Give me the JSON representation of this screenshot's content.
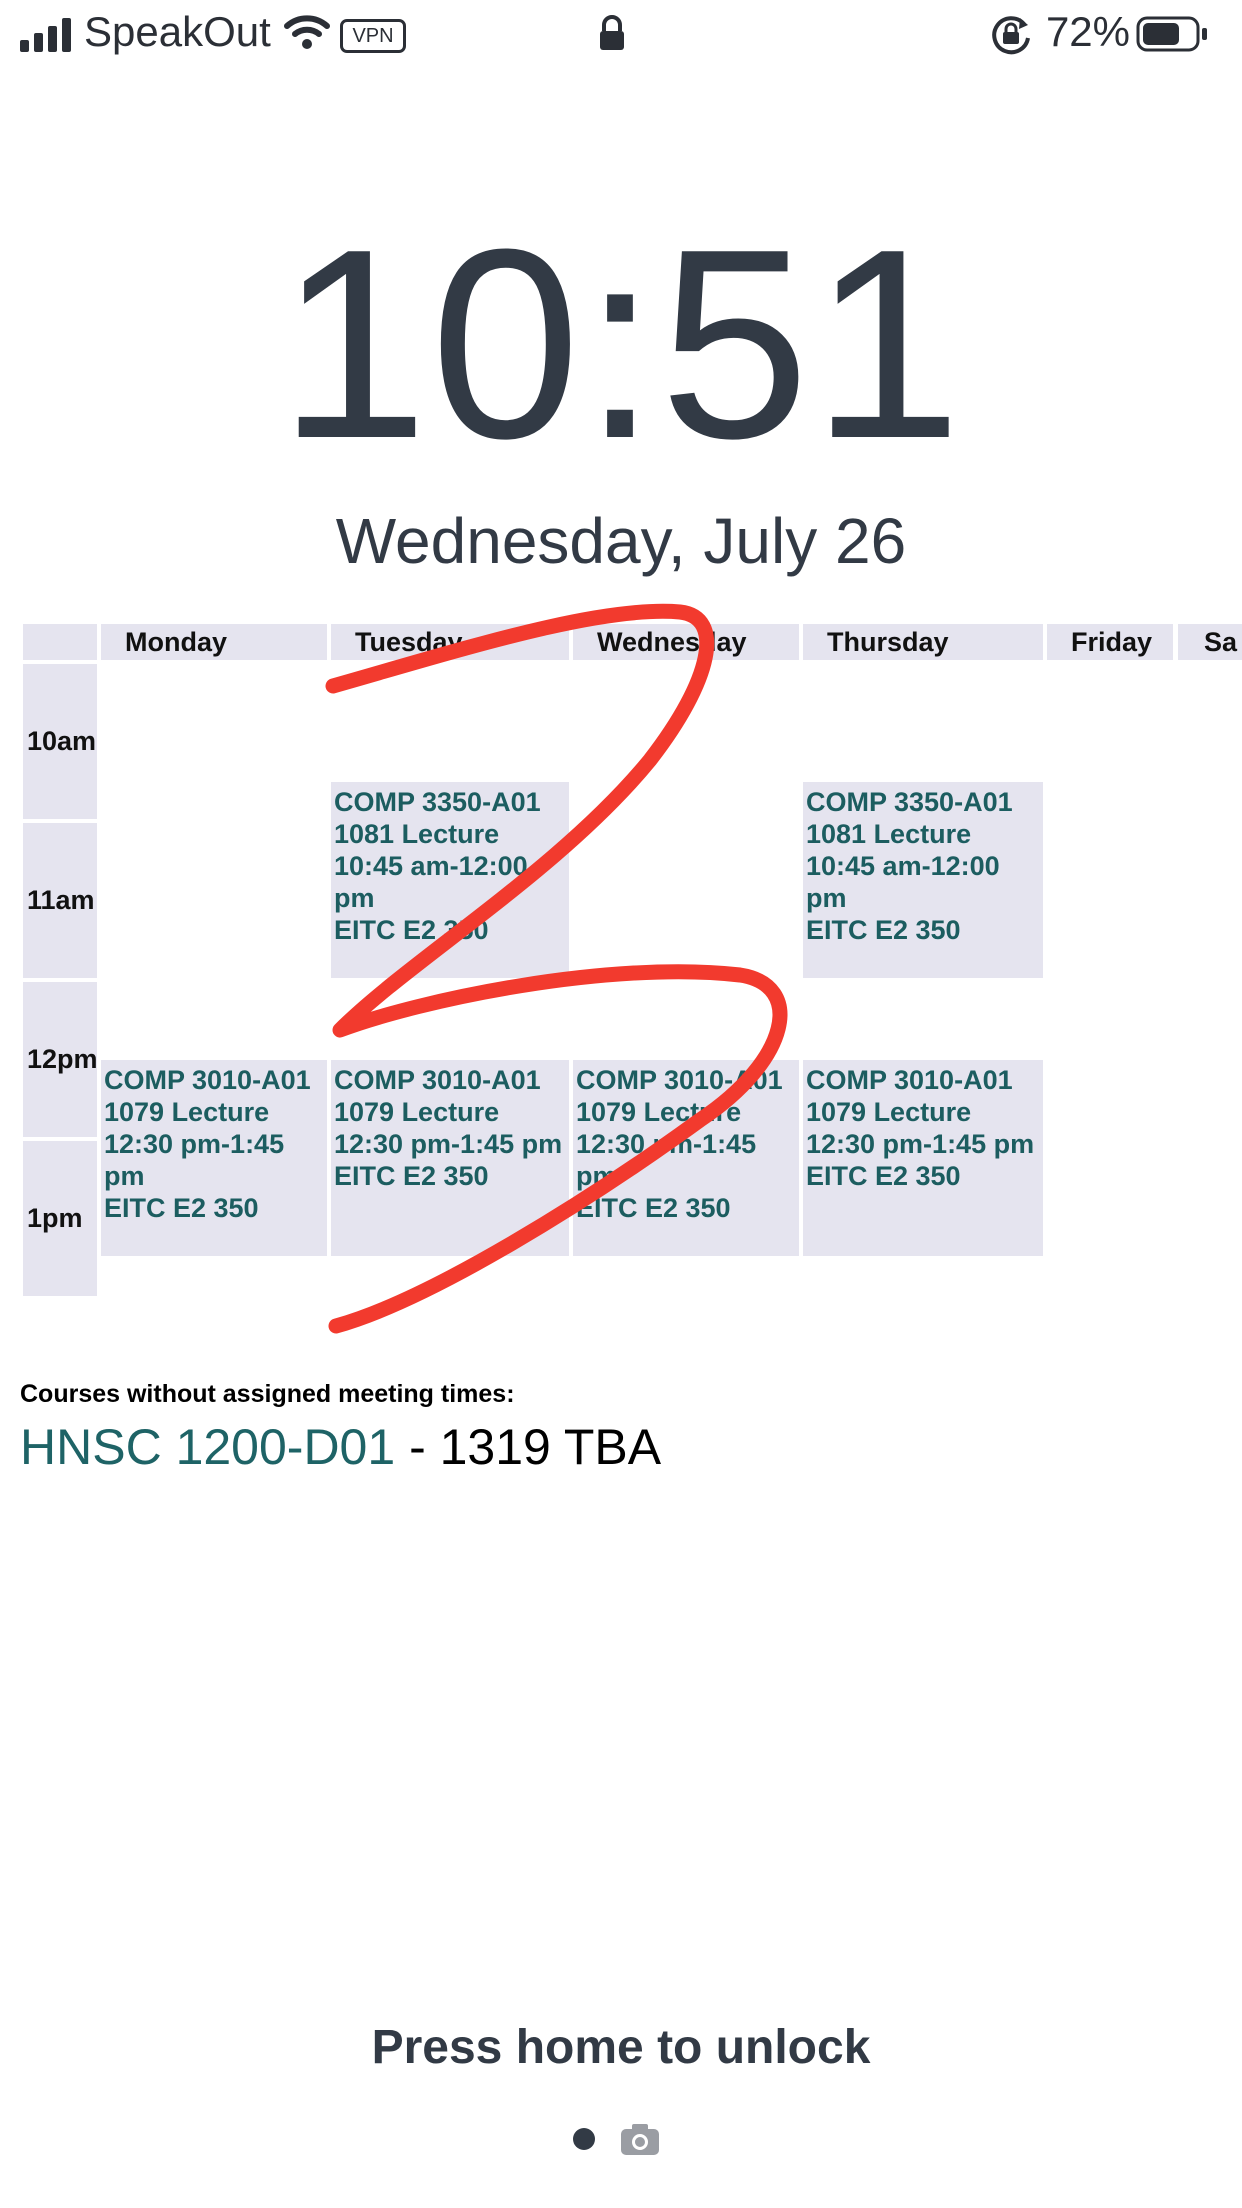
{
  "status_bar": {
    "carrier": "SpeakOut",
    "vpn_label": "VPN",
    "battery_percent": "72%",
    "battery_level": 0.72
  },
  "lock_screen": {
    "time": "10:51",
    "date": "Wednesday, July 26",
    "unlock_hint": "Press home to unlock"
  },
  "schedule": {
    "days": [
      "Monday",
      "Tuesday",
      "Wednesday",
      "Thursday",
      "Friday",
      "Sa"
    ],
    "times": [
      "10am",
      "11am",
      "12pm",
      "1pm"
    ],
    "events": [
      {
        "day": "Tuesday",
        "course": "COMP 3350-A01",
        "type": "1081 Lecture",
        "when": "10:45 am-12:00 pm",
        "room": "EITC E2 350"
      },
      {
        "day": "Thursday",
        "course": "COMP 3350-A01",
        "type": "1081 Lecture",
        "when": "10:45 am-12:00 pm",
        "room": "EITC E2 350"
      },
      {
        "day": "Monday",
        "course": "COMP 3010-A01",
        "type": "1079 Lecture",
        "when": "12:30 pm-1:45 pm",
        "room": "EITC E2 350"
      },
      {
        "day": "Tuesday",
        "course": "COMP 3010-A01",
        "type": "1079 Lecture",
        "when": "12:30 pm-1:45 pm",
        "room": "EITC E2 350"
      },
      {
        "day": "Wednesday",
        "course": "COMP 3010-A01",
        "type": "1079 Lecture",
        "when": "12:30 pm-1:45 pm",
        "room": "EITC E2 350"
      },
      {
        "day": "Thursday",
        "course": "COMP 3010-A01",
        "type": "1079 Lecture",
        "when": "12:30 pm-1:45 pm",
        "room": "EITC E2 350"
      }
    ]
  },
  "unscheduled": {
    "label": "Courses without assigned meeting times:",
    "course": "HNSC 1200-D01",
    "detail": " - 1319 TBA"
  },
  "colors": {
    "text_dark": "#323a45",
    "cell_bg": "#e5e4ef",
    "course_text": "#1c5d60",
    "annotation_red": "#f23a2e"
  }
}
